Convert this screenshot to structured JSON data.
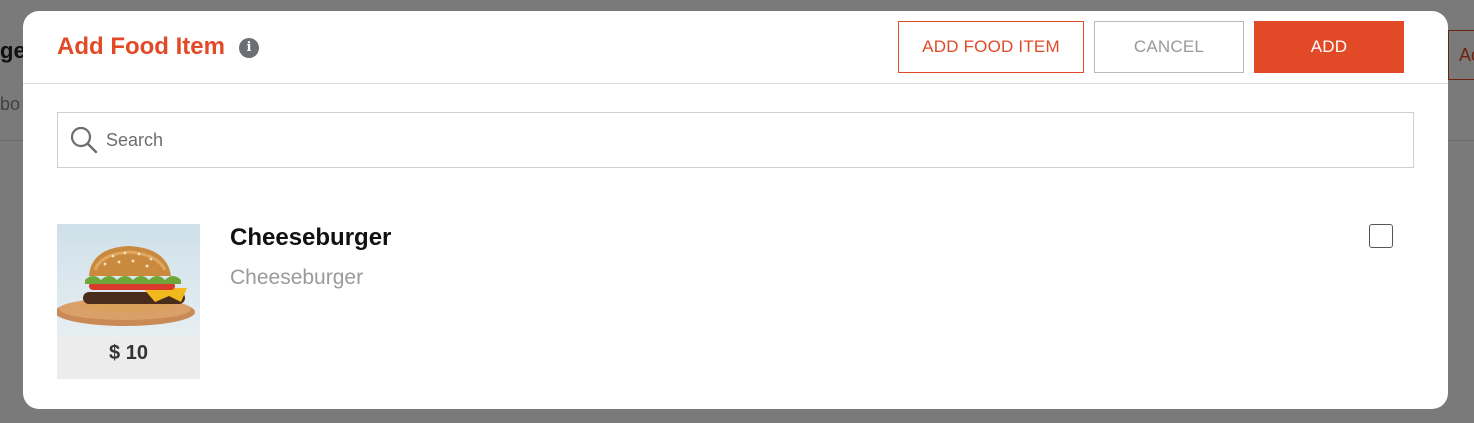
{
  "background": {
    "fragment_title": "ge",
    "fragment_sub": "bo",
    "fragment_button": "Ad"
  },
  "modal": {
    "title": "Add Food Item",
    "info_icon": "info-icon",
    "buttons": {
      "add_food_item": "ADD FOOD ITEM",
      "cancel": "CANCEL",
      "add": "ADD"
    },
    "search": {
      "placeholder": "Search",
      "value": ""
    },
    "items": [
      {
        "name": "Cheeseburger",
        "description": "Cheeseburger",
        "price": "$ 10",
        "image": "cheeseburger-image",
        "checked": false
      }
    ]
  },
  "colors": {
    "accent": "#e24a27",
    "muted_text": "#9a9a9a",
    "info_icon": "#6b6f75"
  }
}
